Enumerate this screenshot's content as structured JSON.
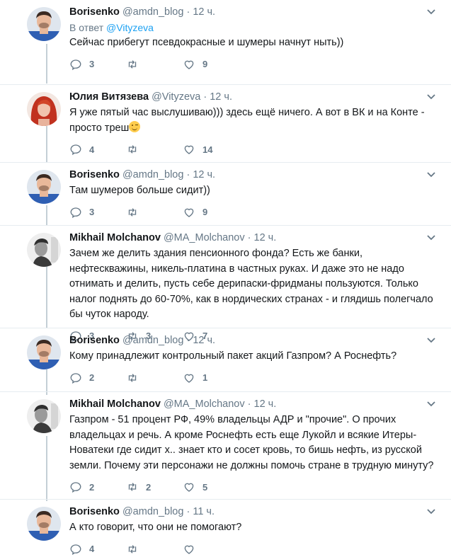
{
  "tweets": [
    {
      "name": "Borisenko",
      "handle": "@amdn_blog",
      "time": "12 ч.",
      "reply_prefix": "В ответ",
      "reply_to": "@Vityzeva",
      "text": "Сейчас прибегут псевдокрасные и шумеры начнут ныть))",
      "replies": "3",
      "retweets": "",
      "likes": "9",
      "avatar": "man-avatar-blue"
    },
    {
      "name": "Юлия Витязева",
      "handle": "@Vityzeva",
      "time": "12 ч.",
      "text": "Я уже пятый час выслушиваю))) здесь ещё ничего. А вот в ВК и на Конте - просто треш",
      "emoji": "wink-emoji",
      "replies": "4",
      "retweets": "",
      "likes": "14",
      "avatar": "woman-avatar-red"
    },
    {
      "name": "Borisenko",
      "handle": "@amdn_blog",
      "time": "12 ч.",
      "text": "Там шумеров больше сидит))",
      "replies": "3",
      "retweets": "",
      "likes": "9",
      "avatar": "man-avatar-blue"
    },
    {
      "name": "Mikhail Molchanov",
      "handle": "@MA_Molchanov",
      "time": "12 ч.",
      "text": "Зачем же делить здания пенсионного фонда? Есть же банки, нефтескважины, никель-платина в частных руках. И даже это не надо отнимать и делить, пусть себе дерипаски-фридманы пользуются. Только налог поднять до 60-70%, как в нордических странах - и глядишь полегчало бы чуток народу.",
      "replies": "3",
      "retweets": "3",
      "likes": "7",
      "avatar": "man-avatar-bw"
    },
    {
      "name": "Borisenko",
      "handle": "@amdn_blog",
      "time": "12 ч.",
      "text": "Кому принадлежит контрольный пакет акций Газпром? А Роснефть?",
      "replies": "2",
      "retweets": "",
      "likes": "1",
      "avatar": "man-avatar-blue"
    },
    {
      "name": "Mikhail Molchanov",
      "handle": "@MA_Molchanov",
      "time": "12 ч.",
      "text": "Газпром - 51 процент РФ, 49% владельцы АДР и \"прочие\". О прочих владельцах и речь. А кроме Роснефть есть еще Лукойл и всякие Итеры-Новатеки где сидит х.. знает кто и сосет кровь, то бишь нефть, из русской земли. Почему эти персонажи не должны помочь стране в трудную минуту?",
      "replies": "2",
      "retweets": "2",
      "likes": "5",
      "avatar": "man-avatar-bw"
    },
    {
      "name": "Borisenko",
      "handle": "@amdn_blog",
      "time": "11 ч.",
      "text": "А кто говорит, что они не помогают?",
      "replies": "4",
      "retweets": "",
      "likes": "",
      "avatar": "man-avatar-blue"
    }
  ],
  "separator_dot": "·",
  "colors": {
    "accent": "#1da1f2",
    "muted": "#657786",
    "thread": "#c4cfd6",
    "border": "#e6ecf0"
  }
}
